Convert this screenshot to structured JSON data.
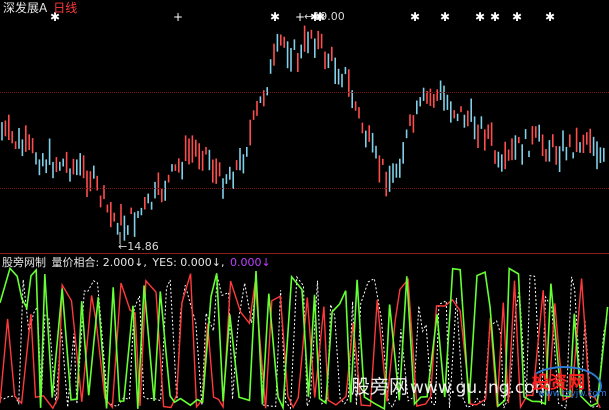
{
  "header": {
    "stock_name": "深发展A",
    "period": "日线"
  },
  "price_panel": {
    "high_label": "←19.00",
    "low_label": "←14.86"
  },
  "indicator": {
    "name": "股旁网制",
    "line1_label": "量价相合: 2.000↓,",
    "line2_label": "YES: 0.000↓,",
    "line3_label": "0.000↓"
  },
  "colors": {
    "background": "#000000",
    "up_candle": "#ff4d4d",
    "down_candle": "#7fd0e8",
    "indicator_green": "#66ff33",
    "indicator_red": "#ff3a3a",
    "indicator_white": "#ffffff",
    "signal_marker": "#ffffff",
    "grid": "#7a1414"
  },
  "icons": {
    "signal_markers": "star-plus-marker"
  },
  "watermark": {
    "site_text": "股旁网",
    "url_text": "www.gu..ng.com",
    "logo_text": "投资网",
    "logo_sub": "www.tzyjw.com"
  }
}
